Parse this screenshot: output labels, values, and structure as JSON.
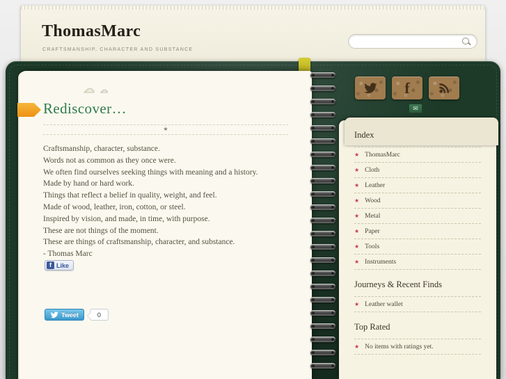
{
  "header": {
    "title": "ThomasMarc",
    "tagline": "CRAFTSMANSHIP, CHARACTER AND SUBSTANCE",
    "search": {
      "value": "",
      "placeholder": ""
    }
  },
  "post": {
    "title": "Rediscover…",
    "lines": [
      "Craftsmanship, character, substance.",
      "Words not as common as they once were.",
      "We often find ourselves seeking things with meaning and a history.",
      "Made by hand or hard work.",
      "Things that reflect a belief in quality, weight, and feel.",
      "Made of wood, leather, iron, cotton, or steel.",
      "Inspired by vision, and made, in time, with purpose.",
      "These are not things of the moment.",
      "These are things of craftsmanship, character, and substance.",
      "- Thomas Marc"
    ],
    "like_label": "Like",
    "tweet_label": "Tweet",
    "tweet_count": "0"
  },
  "glyphs": {
    "cloud_large": "☁",
    "cloud_small": "☁",
    "separator_star": "★",
    "bullet_star": "★",
    "facebook_f": "f",
    "envelope": "✉"
  },
  "sidebar": {
    "sections": [
      {
        "heading": "Index",
        "items": [
          "ThomasMarc",
          "Cloth",
          "Leather",
          "Wood",
          "Metal",
          "Paper",
          "Tools",
          "Instruments"
        ]
      },
      {
        "heading": "Journeys & Recent Finds",
        "items": [
          "Leather wallet"
        ]
      },
      {
        "heading": "Top Rated",
        "items": [
          "No items with ratings yet."
        ]
      }
    ]
  },
  "colors": {
    "leather_green": "#1d3a29",
    "accent_green": "#2f7a4c",
    "star_red": "#c53a55",
    "tab_yellow": "#c9c02a",
    "arrow_orange": "#f09c1e",
    "facebook_blue": "#3b5998",
    "twitter_blue": "#4aa8d8"
  }
}
